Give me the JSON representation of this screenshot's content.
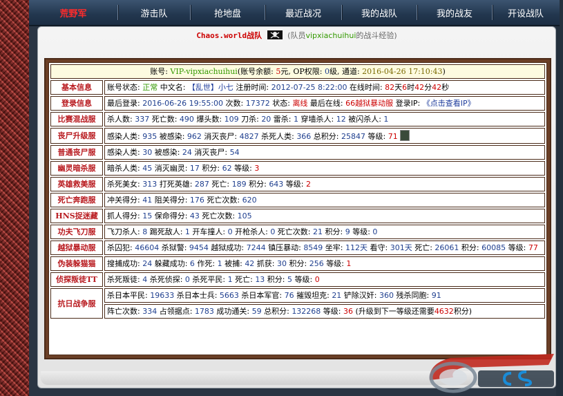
{
  "nav": {
    "items": [
      "荒野军",
      "游击队",
      "抢地盘",
      "最近战况",
      "我的战队",
      "我的战友",
      "开设战队"
    ]
  },
  "banner": {
    "team": "Chaos.world",
    "team_suffix": "战队",
    "paren_prefix": "(队员",
    "member": "vipxiachuihui",
    "paren_suffix": "的战斗经验)"
  },
  "account": {
    "l1": "账号: ",
    "id": "VIP-vipxiachuihui",
    "l2": "(账号余额: ",
    "balance": "5",
    "l3": "元, OP权限: ",
    "op": "0",
    "l4": "级, 通道: ",
    "date": "2016-04-26 17:10:43",
    "l5": ")"
  },
  "rows": {
    "basic": {
      "label": "基本信息",
      "t1": "账号状态: ",
      "status": "正常",
      "t2": " 中文名: ",
      "name": "【乱世】小七",
      "t3": " 注册时间: ",
      "reg": "2012-07-25 8:22:00",
      "t4": " 在线时间: ",
      "d": "82",
      "t5": "天",
      "h": "6",
      "t6": "时",
      "m": "42",
      "t7": "分",
      "s": "42",
      "t8": "秒"
    },
    "login": {
      "label": "登录信息",
      "t1": "最后登录: ",
      "last": "2016-06-26 19:55:00",
      "t2": " 次数: ",
      "count": "17372",
      "t3": " 状态: ",
      "state": "离线",
      "t4": " 最后在线: ",
      "server": "66越狱暴动服",
      "t5": " 登录IP: ",
      "ip": "《点击查看IP》"
    },
    "match": {
      "label": "比赛混战服",
      "t1": "杀人数: ",
      "a": "337",
      "t2": " 死亡数: ",
      "b": "490",
      "t3": " 爆头数: ",
      "c": "109",
      "t4": " 刀杀: ",
      "d": "20",
      "t5": " 雷杀: ",
      "e": "1",
      "t6": " 穿墙杀人: ",
      "f": "12",
      "t7": " 被闪杀人: ",
      "g": "1"
    },
    "zombie_up": {
      "label": "丧尸升级服",
      "t1": "感染人类: ",
      "a": "935",
      "t2": " 被感染: ",
      "b": "962",
      "t3": " 消灭丧尸: ",
      "c": "4827",
      "t4": " 杀死人类: ",
      "d": "366",
      "t5": " 总积分: ",
      "e": "25847",
      "t6": " 等级: ",
      "f": "71"
    },
    "zombie": {
      "label": "普通丧尸服",
      "t1": "感染人类: ",
      "a": "30",
      "t2": " 被感染: ",
      "b": "24",
      "t3": " 消灭丧尸: ",
      "c": "54"
    },
    "ghost": {
      "label": "幽灵暗杀服",
      "t1": "暗杀人类: ",
      "a": "45",
      "t2": " 消灭幽灵: ",
      "b": "17",
      "t3": " 积分: ",
      "c": "62",
      "t4": " 等级: ",
      "d": "3"
    },
    "hero": {
      "label": "英雄救美服",
      "t1": "杀死美女: ",
      "a": "313",
      "t2": " 打死英雄: ",
      "b": "287",
      "t3": " 死亡: ",
      "c": "189",
      "t4": " 积分: ",
      "d": "643",
      "t5": " 等级: ",
      "e": "2"
    },
    "run": {
      "label": "死亡奔跑服",
      "t1": "冲关得分: ",
      "a": "41",
      "t2": " 阻关得分: ",
      "b": "176",
      "t3": " 死亡次数: ",
      "c": "620"
    },
    "hns": {
      "label": "HNS捉迷藏",
      "t1": "抓人得分: ",
      "a": "15",
      "t2": " 保命得分: ",
      "b": "43",
      "t3": " 死亡次数: ",
      "c": "105"
    },
    "kungfu": {
      "label": "功夫飞刀服",
      "t1": "飞刀杀人: ",
      "a": "8",
      "t2": " 踢死敌人: ",
      "b": "1",
      "t3": " 开车撞人: ",
      "c": "0",
      "t4": " 开枪杀人: ",
      "d": "0",
      "t5": " 死亡次数: ",
      "e": "21",
      "t6": " 积分: ",
      "f": "9",
      "t7": " 等级: ",
      "g": "0"
    },
    "prison": {
      "label": "越狱暴动服",
      "t1": "杀囚犯: ",
      "a": "46604",
      "t2": " 杀狱警: ",
      "b": "9454",
      "t3": " 越狱成功: ",
      "c": "7244",
      "t4": " 镇压暴动: ",
      "d": "8549",
      "t5": " 坐牢: ",
      "e": "112天",
      "t6": " 看守: ",
      "f": "301天",
      "t7": " 死亡: ",
      "g": "26061",
      "t8": " 积分: ",
      "h": "60085",
      "t9": " 等级: ",
      "i": "77"
    },
    "cat": {
      "label": "伪装躲猫猫",
      "t1": "搜捕成功: ",
      "a": "24",
      "t2": " 躲藏成功: ",
      "b": "6",
      "t3": " 作死: ",
      "c": "1",
      "t4": " 被捕: ",
      "d": "42",
      "t5": " 抓获: ",
      "e": "30",
      "t6": " 积分: ",
      "f": "256",
      "t7": " 等级: ",
      "g": "1"
    },
    "traitor": {
      "label": "侦探叛徒TT",
      "t1": "杀死叛徒: ",
      "a": "4",
      "t2": " 杀死侦探: ",
      "b": "0",
      "t3": " 杀死平民: ",
      "c": "1",
      "t4": " 死亡: ",
      "d": "13",
      "t5": " 积分: ",
      "e": "5",
      "t6": " 等级: ",
      "f": "0"
    },
    "war": {
      "label": "抗日战争服",
      "t1": "杀日本平民: ",
      "a": "19633",
      "t2": " 杀日本士兵: ",
      "b": "5663",
      "t3": " 杀日本军官: ",
      "c": "76",
      "t4": " 摧毁坦克: ",
      "d": "21",
      "t5": " 铲除汉奸: ",
      "e": "360",
      "t6": " 残杀同胞: ",
      "f": "91",
      "u1": "阵亡次数: ",
      "g": "334",
      "u2": " 占领据点: ",
      "h": "1783",
      "u3": " 成功通关: ",
      "i": "59",
      "u4": " 总积分: ",
      "j": "132268",
      "u5": " 等级: ",
      "k": "36",
      "u6": " (升级到下一等级还需要",
      "l": "4632",
      "u7": "积分)"
    }
  },
  "colors": {
    "nav_top": "#3c5470",
    "label_red": "#b8191e",
    "green": "#339900",
    "red": "#cc0000",
    "board": "#6b3f26"
  }
}
